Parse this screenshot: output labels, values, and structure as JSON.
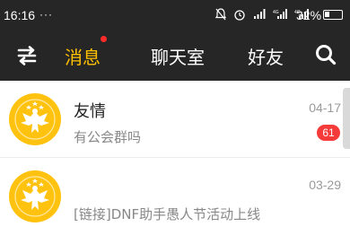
{
  "status_bar": {
    "time": "16:16",
    "dots": "···",
    "battery_text": "32%",
    "battery_level": 0.32,
    "icons": [
      "mute-bell-icon",
      "alarm-icon",
      "signal-icon",
      "4g-signal-icon",
      "4g-signal-icon"
    ]
  },
  "nav": {
    "menu_icon": "menu-transfer-icon",
    "tabs": [
      {
        "label": "消息",
        "active": true,
        "has_dot": true
      },
      {
        "label": "聊天室",
        "active": false
      },
      {
        "label": "好友",
        "active": false
      }
    ],
    "search_icon": "search-icon",
    "accent": "#ffc200"
  },
  "conversations": [
    {
      "title": "友情",
      "subtitle": "有公会群吗",
      "date": "04-17",
      "unread": "61",
      "avatar_icon": "eagle-emblem-icon"
    },
    {
      "title": "",
      "subtitle": "[链接]DNF助手愚人节活动上线",
      "date": "03-29",
      "unread": "",
      "avatar_icon": "eagle-emblem-icon"
    }
  ],
  "colors": {
    "dark_bar": "#262626",
    "avatar_yellow": "#ffc20e",
    "badge_red": "#f53a3a"
  }
}
